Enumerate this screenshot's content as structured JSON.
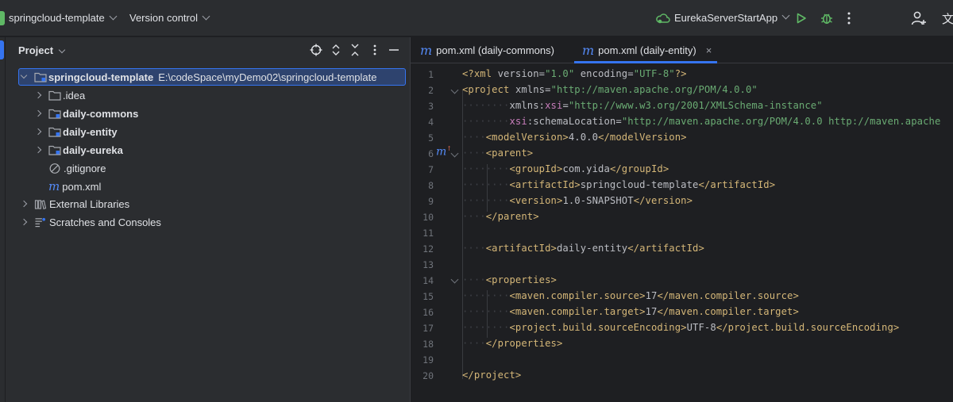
{
  "topbar": {
    "project_name": "springcloud-template",
    "vcs_label": "Version control",
    "run_config": "EurekaServerStartApp",
    "icons": [
      "cloud-icon",
      "run-icon",
      "debug-icon",
      "more-icon",
      "add-user-icon",
      "translate-icon"
    ],
    "translate_glyph": "文"
  },
  "project_panel": {
    "title": "Project",
    "tree": [
      {
        "label": "springcloud-template",
        "path": "E:\\codeSpace\\myDemo02\\springcloud-template",
        "expanded": true,
        "selected": true
      },
      {
        "label": ".idea"
      },
      {
        "label": "daily-commons"
      },
      {
        "label": "daily-entity"
      },
      {
        "label": "daily-eureka"
      },
      {
        "label": ".gitignore"
      },
      {
        "label": "pom.xml"
      },
      {
        "label": "External Libraries"
      },
      {
        "label": "Scratches and Consoles"
      }
    ]
  },
  "editor": {
    "tabs": [
      {
        "label": "pom.xml (daily-commons)",
        "active": false
      },
      {
        "label": "pom.xml (daily-entity)",
        "active": true,
        "close": "×"
      }
    ],
    "maven_icon_glyph": "m",
    "line_numbers": [
      "1",
      "2",
      "3",
      "4",
      "5",
      "6",
      "7",
      "8",
      "9",
      "10",
      "11",
      "12",
      "13",
      "14",
      "15",
      "16",
      "17",
      "18",
      "19",
      "20"
    ],
    "code": {
      "l1": [
        "<?xml ",
        "version=",
        "\"1.0\"",
        " encoding=",
        "\"UTF-8\"",
        "?>"
      ],
      "l2": [
        "<project ",
        "xmlns=",
        "\"http://maven.apache.org/POM/4.0.0\""
      ],
      "l3": [
        "xmlns:",
        "xsi",
        "=",
        "\"http://www.w3.org/2001/XMLSchema-instance\""
      ],
      "l4": [
        "xsi",
        ":schemaLocation=",
        "\"http://maven.apache.org/POM/4.0.0 http://maven.apache"
      ],
      "l5": [
        "<modelVersion>",
        "4.0.0",
        "</modelVersion>"
      ],
      "l6": [
        "<parent>"
      ],
      "l7": [
        "<groupId>",
        "com.yida",
        "</groupId>"
      ],
      "l8": [
        "<artifactId>",
        "springcloud-template",
        "</artifactId>"
      ],
      "l9": [
        "<version>",
        "1.0-SNAPSHOT",
        "</version>"
      ],
      "l10": [
        "</parent>"
      ],
      "l12": [
        "<artifactId>",
        "daily-entity",
        "</artifactId>"
      ],
      "l14": [
        "<properties>"
      ],
      "l15": [
        "<maven.compiler.source>",
        "17",
        "</maven.compiler.source>"
      ],
      "l16": [
        "<maven.compiler.target>",
        "17",
        "</maven.compiler.target>"
      ],
      "l17": [
        "<project.build.sourceEncoding>",
        "UTF-8",
        "</project.build.sourceEncoding>"
      ],
      "l18": [
        "</properties>"
      ],
      "l20": [
        "</project>"
      ]
    }
  },
  "colors": {
    "accent": "#3574f0",
    "tag": "#d5b778",
    "string": "#6aab73",
    "namespace": "#c77dbb",
    "run_green": "#5fb865"
  }
}
